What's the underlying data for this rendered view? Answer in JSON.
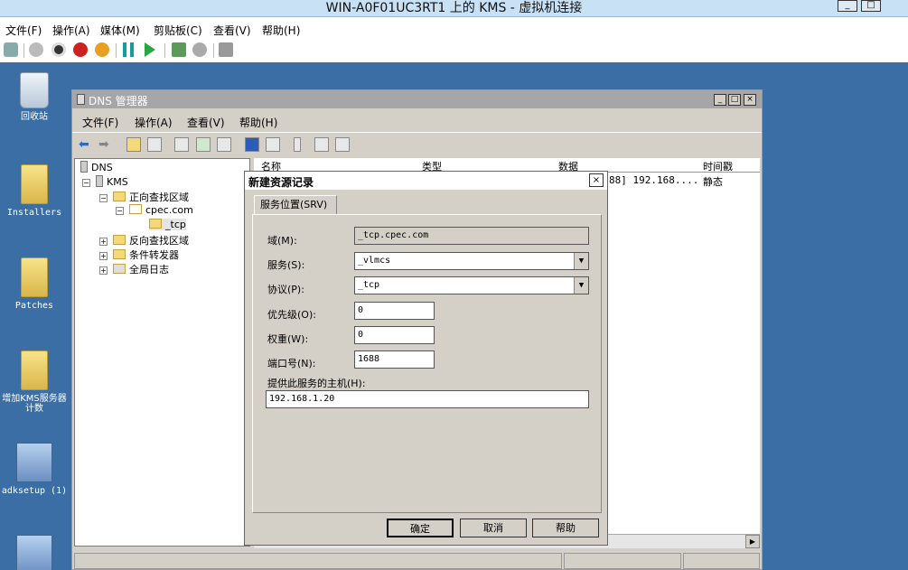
{
  "window": {
    "title": "WIN-A0F01UC3RT1 上的 KMS - 虚拟机连接",
    "menu": [
      "文件(F)",
      "操作(A)",
      "媒体(M)",
      "剪贴板(C)",
      "查看(V)",
      "帮助(H)"
    ],
    "toolbar_icons": [
      "ctrl-alt-del-icon",
      "start-icon",
      "turnoff-icon",
      "shutdown-icon",
      "save-icon",
      "pause-icon",
      "resume-icon",
      "checkpoint-icon",
      "revert-icon",
      "enhanced-session-icon"
    ]
  },
  "desktop": {
    "background": "#3a6ea5",
    "icons": [
      {
        "label": "回收站",
        "icon": "recycle-bin-icon"
      },
      {
        "label": "Installers",
        "icon": "folder-icon"
      },
      {
        "label": "Patches",
        "icon": "folder-icon"
      },
      {
        "label": "增加KMS服务器计数",
        "icon": "folder-icon"
      },
      {
        "label": "adksetup (1)",
        "icon": "setup-icon"
      }
    ]
  },
  "mmc": {
    "title": "DNS 管理器",
    "menu": [
      "文件(F)",
      "操作(A)",
      "查看(V)",
      "帮助(H)"
    ],
    "tree": [
      "DNS",
      "KMS",
      "正向查找区域",
      "cpec.com",
      "_tcp",
      "反向查找区域",
      "条件转发器",
      "全局日志"
    ],
    "columns": [
      "名称",
      "类型",
      "数据",
      "时间戳"
    ],
    "row": {
      "data": "88] 192.168....",
      "timestamp": "静态"
    }
  },
  "dialog": {
    "title": "新建资源记录",
    "tab": "服务位置(SRV)",
    "domain_label": "域(M):",
    "domain_value": "_tcp.cpec.com",
    "service_label": "服务(S):",
    "service_value": "_vlmcs",
    "protocol_label": "协议(P):",
    "protocol_value": "_tcp",
    "priority_label": "优先级(O):",
    "priority_value": "0",
    "weight_label": "权重(W):",
    "weight_value": "0",
    "port_label": "端口号(N):",
    "port_value": "1688",
    "host_label": "提供此服务的主机(H):",
    "host_value": "192.168.1.20",
    "ok": "确定",
    "cancel": "取消",
    "help": "帮助"
  }
}
